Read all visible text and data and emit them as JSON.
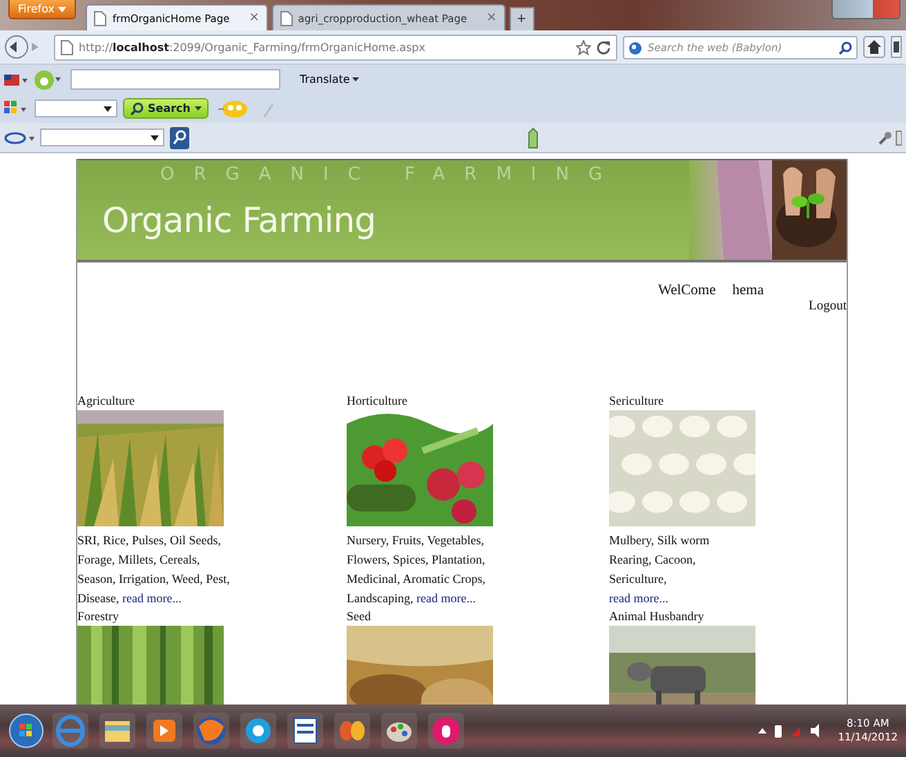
{
  "browser": {
    "menu_button": "Firefox",
    "tabs": [
      {
        "title": "frmOrganicHome Page",
        "close": "×",
        "selected": true
      },
      {
        "title": "agri_cropproduction_wheat Page",
        "close": "×",
        "selected": false
      }
    ],
    "new_tab": "+",
    "address": "http://**localhost**:2099/Organic_Farming/frmOrganicHome.aspx",
    "search_placeholder": "Search the web (Babylon)"
  },
  "toolbars": {
    "translate": "Translate",
    "search_button": "Search"
  },
  "page": {
    "banner": {
      "title": "Organic Farming",
      "watermark": "ORGANIC FARMING"
    },
    "welcome": "WelCome",
    "user": "hema",
    "logout": "Logout",
    "categories": [
      {
        "title": "Agriculture",
        "description": [
          [
            {
              "kind": "text",
              "text": "SRI, Rice, Pulses, Oil Seeds,"
            }
          ],
          [
            {
              "kind": "text",
              "text": "Forage, Millets, Cereals,"
            }
          ],
          [
            {
              "kind": "text",
              "text": "Season, Irrigation, Weed, Pest,"
            }
          ],
          [
            {
              "kind": "text",
              "text": "Disease,"
            },
            {
              "kind": "link",
              "text": "read more..."
            }
          ]
        ]
      },
      {
        "title": "Horticulture",
        "description": [
          [
            {
              "kind": "text",
              "text": "Nursery, Fruits, Vegetables,"
            }
          ],
          [
            {
              "kind": "text",
              "text": "Flowers, Spices, Plantation,"
            }
          ],
          [
            {
              "kind": "text",
              "text": "Medicinal, Aromatic Crops,"
            }
          ],
          [
            {
              "kind": "text",
              "text": "Landscaping,"
            },
            {
              "kind": "link",
              "text": "read more..."
            }
          ]
        ]
      },
      {
        "title": "Sericulture",
        "description": [
          [
            {
              "kind": "text",
              "text": "Mulbery, Silk worm"
            }
          ],
          [
            {
              "kind": "text",
              "text": "Rearing, Cacoon,"
            }
          ],
          [
            {
              "kind": "text",
              "text": "Sericulture,"
            }
          ],
          [
            {
              "kind": "link",
              "text": "read more..."
            }
          ]
        ]
      },
      {
        "title": "Forestry"
      },
      {
        "title": "Seed"
      },
      {
        "title": "Animal Husbandry"
      }
    ]
  },
  "taskbar": {
    "time": "8:10 AM",
    "date": "11/14/2012"
  }
}
